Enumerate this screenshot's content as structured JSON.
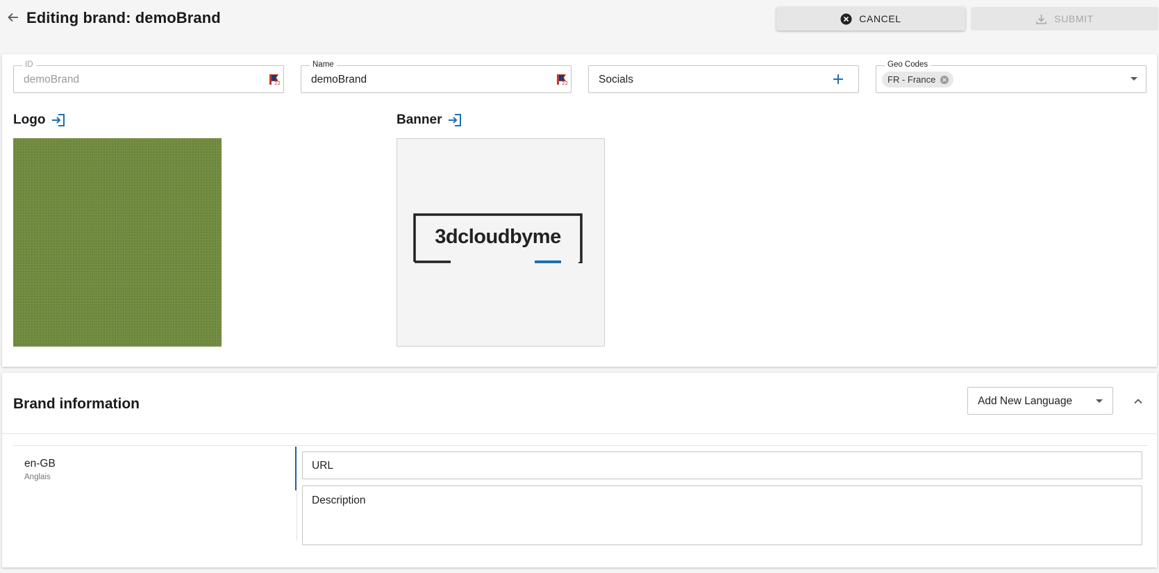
{
  "header": {
    "title": "Editing brand: demoBrand",
    "cancel_label": "CANCEL",
    "submit_label": "SUBMIT"
  },
  "fields": {
    "id": {
      "label": "ID",
      "value": "demoBrand"
    },
    "name": {
      "label": "Name",
      "value": "demoBrand"
    },
    "socials": {
      "placeholder": "Socials"
    },
    "geo_codes": {
      "label": "Geo Codes",
      "chips": [
        "FR - France"
      ]
    }
  },
  "media": {
    "logo_label": "Logo",
    "banner_label": "Banner",
    "banner_text": "3dcloudbyme"
  },
  "brand_info": {
    "title": "Brand information",
    "language_select": "Add New Language",
    "languages": [
      {
        "code": "en-GB",
        "name": "Anglais"
      }
    ],
    "url_placeholder": "URL",
    "description_placeholder": "Description"
  },
  "colors": {
    "accent": "#1e6fb0",
    "background": "#f5f5f5",
    "logo_fill": "#6e8a3a"
  },
  "icons": [
    "back-arrow-icon",
    "cancel-circle-icon",
    "download-icon",
    "flag-icon",
    "plus-icon",
    "chip-close-icon",
    "dropdown-icon",
    "import-icon",
    "chevron-up-icon"
  ]
}
